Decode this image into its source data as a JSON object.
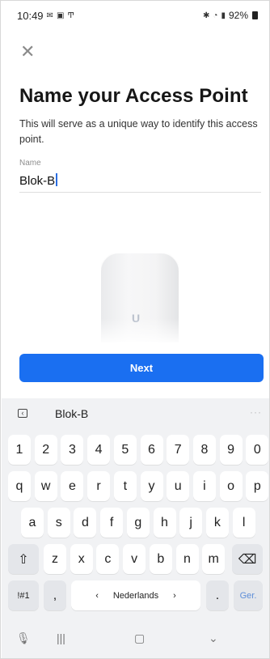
{
  "status_bar": {
    "time": "10:49",
    "left_icons": [
      "message-icon",
      "gallery-icon",
      "antenna-icon"
    ],
    "battery": "92%"
  },
  "page": {
    "title": "Name your Access Point",
    "description": "This will serve as a unique way to identify this access point.",
    "name_field": {
      "label": "Name",
      "value": "Blok-B"
    },
    "next_label": "Next",
    "device_logo": "U"
  },
  "keyboard": {
    "suggestion": "Blok-B",
    "row_numbers": [
      "1",
      "2",
      "3",
      "4",
      "5",
      "6",
      "7",
      "8",
      "9",
      "0"
    ],
    "row_top": [
      "q",
      "w",
      "e",
      "r",
      "t",
      "y",
      "u",
      "i",
      "o",
      "p"
    ],
    "row_middle": [
      "a",
      "s",
      "d",
      "f",
      "g",
      "h",
      "j",
      "k",
      "l"
    ],
    "row_bottom": [
      "z",
      "x",
      "c",
      "v",
      "b",
      "n",
      "m"
    ],
    "symbols_label": "!#1",
    "comma": ",",
    "language": "Nederlands",
    "period": ".",
    "enter_label": "Ger."
  }
}
